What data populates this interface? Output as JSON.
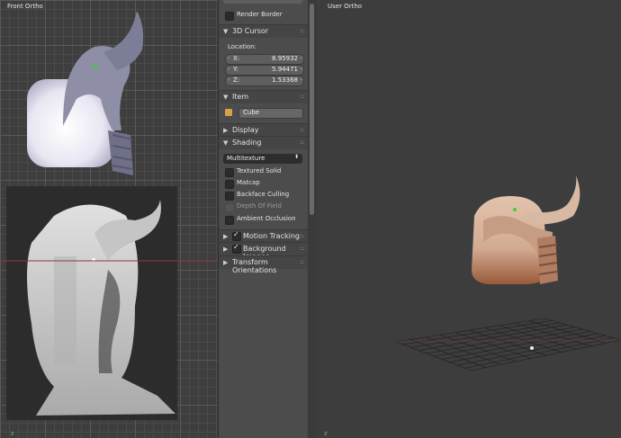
{
  "viewport_left": {
    "label": "Front Ortho",
    "axis": "z"
  },
  "viewport_right": {
    "label": "User Ortho",
    "axis": "z"
  },
  "panel": {
    "top_row": {
      "label": "Render Border",
      "checked": false
    },
    "cursor": {
      "header": "3D Cursor",
      "location_label": "Location:",
      "x_key": "X:",
      "x_val": "8.95932",
      "y_key": "Y:",
      "y_val": "5.94471",
      "z_key": "Z:",
      "z_val": "1.53368"
    },
    "item": {
      "header": "Item",
      "name": "Cube"
    },
    "display": {
      "header": "Display"
    },
    "shading": {
      "header": "Shading",
      "mode": "Multitexture",
      "options": [
        {
          "label": "Textured Solid",
          "checked": false,
          "enabled": true
        },
        {
          "label": "Matcap",
          "checked": false,
          "enabled": true
        },
        {
          "label": "Backface Culling",
          "checked": false,
          "enabled": true
        },
        {
          "label": "Depth Of Field",
          "checked": false,
          "enabled": false
        },
        {
          "label": "Ambient Occlusion",
          "checked": false,
          "enabled": true
        }
      ]
    },
    "motion_tracking": {
      "header": "Motion Tracking",
      "checked": true
    },
    "background_images": {
      "header": "Background Images",
      "checked": true
    },
    "transform_orientations": {
      "header": "Transform Orientations"
    }
  },
  "colors": {
    "panel_bg": "#4c4c4c",
    "viewport_bg": "#3e3e3e",
    "model_gray": "#9a9bb0",
    "model_skin": "#cfa78d"
  }
}
